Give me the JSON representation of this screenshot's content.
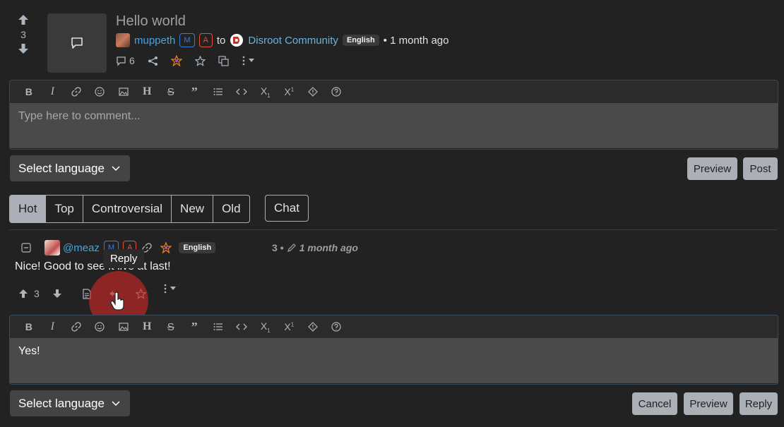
{
  "post": {
    "score": "3",
    "title": "Hello world",
    "author": "muppeth",
    "mod_badge": "M",
    "admin_badge": "A",
    "to_text": "to",
    "community": "Disroot Community",
    "language": "English",
    "time": "• 1 month ago",
    "comment_count": "6"
  },
  "editor_toolbar": [
    "bold",
    "italic",
    "link",
    "emoji",
    "image",
    "header",
    "strikethrough",
    "quote",
    "list",
    "code",
    "subscript",
    "superscript",
    "spoiler",
    "help"
  ],
  "editor": {
    "placeholder": "Type here to comment...",
    "select_language": "Select language",
    "preview_label": "Preview",
    "post_label": "Post"
  },
  "sort_tabs": [
    {
      "label": "Hot",
      "active": true
    },
    {
      "label": "Top",
      "active": false
    },
    {
      "label": "Controversial",
      "active": false
    },
    {
      "label": "New",
      "active": false
    },
    {
      "label": "Old",
      "active": false
    }
  ],
  "chat_label": "Chat",
  "comment": {
    "author": "@meaz",
    "mod_badge": "M",
    "admin_badge": "A",
    "language": "English",
    "score": "3",
    "dot": "•",
    "time": "1 month ago",
    "text": "Nice! Good to see it live at last!",
    "upvotes": "3",
    "tooltip": "Reply"
  },
  "reply_editor": {
    "value": "Yes!",
    "select_language": "Select language",
    "cancel_label": "Cancel",
    "preview_label": "Preview",
    "reply_label": "Reply"
  },
  "colors": {
    "background": "#222222",
    "accent_link": "#4aa3df",
    "button": "#aab0b6",
    "admin": "#e74c3c",
    "mod": "#3a7bd5"
  }
}
